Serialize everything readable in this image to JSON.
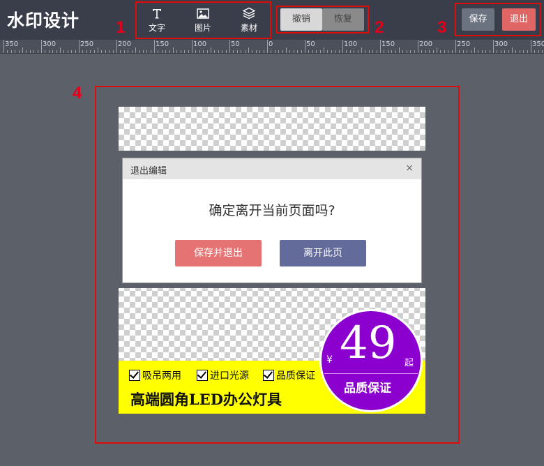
{
  "app": {
    "logo": "水印设计"
  },
  "callouts": [
    "1",
    "2",
    "3",
    "4"
  ],
  "toolbar": {
    "tools": [
      {
        "label": "文字",
        "icon": "text-icon"
      },
      {
        "label": "图片",
        "icon": "image-icon"
      },
      {
        "label": "素材",
        "icon": "layers-icon"
      }
    ],
    "undo_label": "撤销",
    "redo_label": "恢复",
    "save_label": "保存",
    "exit_label": "退出"
  },
  "ruler": {
    "ticks": [
      "350",
      "300",
      "250",
      "200",
      "150",
      "100",
      "50",
      "0",
      "50",
      "100",
      "150",
      "200",
      "250",
      "300",
      "350"
    ]
  },
  "dialog": {
    "title": "退出编辑",
    "close": "×",
    "message": "确定离开当前页面吗?",
    "save_exit_label": "保存并退出",
    "leave_label": "离开此页"
  },
  "product": {
    "features": [
      "吸吊两用",
      "进口光源",
      "品质保证"
    ],
    "title": "高端圆角LED办公灯具",
    "currency": "¥",
    "price": "49",
    "price_suffix": "起",
    "badge": "品质保证"
  },
  "colors": {
    "topbar": "#3a3e4b",
    "workspace": "#5c6069",
    "callout_red": "#e3001b",
    "save_exit": "#e57373",
    "leave": "#636b9a",
    "exit_button": "#e06666",
    "badge_purple": "#8b00ce",
    "banner_yellow": "#ffff00"
  }
}
